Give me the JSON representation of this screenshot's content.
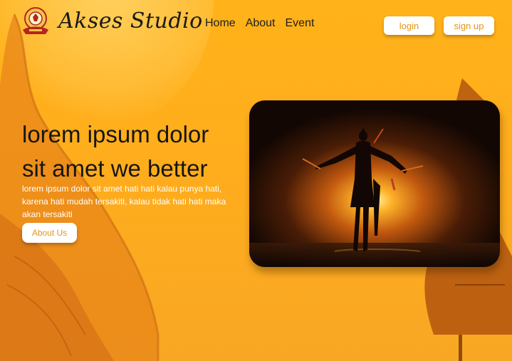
{
  "brand": {
    "name": "Akses Studio",
    "logo_icon": "wayang-emblem-icon"
  },
  "nav": {
    "items": [
      {
        "label": "Home"
      },
      {
        "label": "About"
      },
      {
        "label": "Event"
      }
    ]
  },
  "auth": {
    "login_label": "login",
    "signup_label": "sign up"
  },
  "hero": {
    "title_line1": "lorem ipsum dolor",
    "title_line2": "sit amet we better",
    "description": "lorem ipsum dolor sit amet hati hati kalau punya hati, karena hati mudah tersakiti, kalau tidak hati hati maka akan tersakiti",
    "cta_label": "About Us"
  },
  "colors": {
    "accent": "#e0961a",
    "background": "#ffb21a",
    "dark": "#151515"
  }
}
